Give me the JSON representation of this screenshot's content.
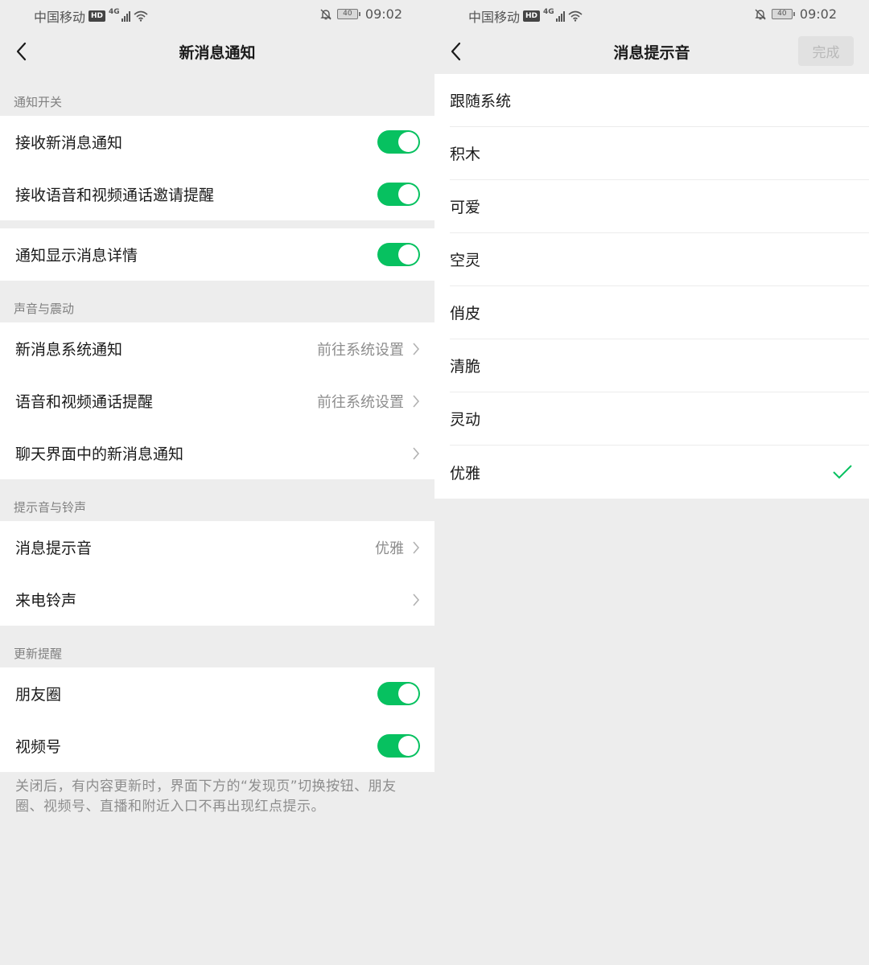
{
  "status_bar": {
    "carrier": "中国移动",
    "hd": "HD",
    "network": "4G",
    "battery": "40",
    "time": "09:02"
  },
  "left": {
    "title": "新消息通知",
    "sections": {
      "notify": {
        "header": "通知开关",
        "receive_new": "接收新消息通知",
        "receive_call": "接收语音和视频通话邀请提醒",
        "show_detail": "通知显示消息详情"
      },
      "sound": {
        "header": "声音与震动",
        "new_msg_system": "新消息系统通知",
        "new_msg_system_value": "前往系统设置",
        "call_remind": "语音和视频通话提醒",
        "call_remind_value": "前往系统设置",
        "chat_new_msg": "聊天界面中的新消息通知"
      },
      "ringtone": {
        "header": "提示音与铃声",
        "msg_tone": "消息提示音",
        "msg_tone_value": "优雅",
        "call_ring": "来电铃声"
      },
      "update": {
        "header": "更新提醒",
        "moments": "朋友圈",
        "channels": "视频号",
        "footnote": "关闭后，有内容更新时，界面下方的“发现页”切换按钮、朋友圈、视频号、直播和附近入口不再出现红点提示。"
      }
    },
    "toggles": {
      "receive_new": true,
      "receive_call": true,
      "show_detail": true,
      "moments": true,
      "channels": true
    }
  },
  "right": {
    "title": "消息提示音",
    "done_label": "完成",
    "options": [
      "跟随系统",
      "积木",
      "可爱",
      "空灵",
      "俏皮",
      "清脆",
      "灵动",
      "优雅"
    ],
    "selected": "优雅"
  },
  "colors": {
    "accent": "#07c160",
    "background": "#ededed",
    "secondary_text": "#8d8d8d"
  }
}
